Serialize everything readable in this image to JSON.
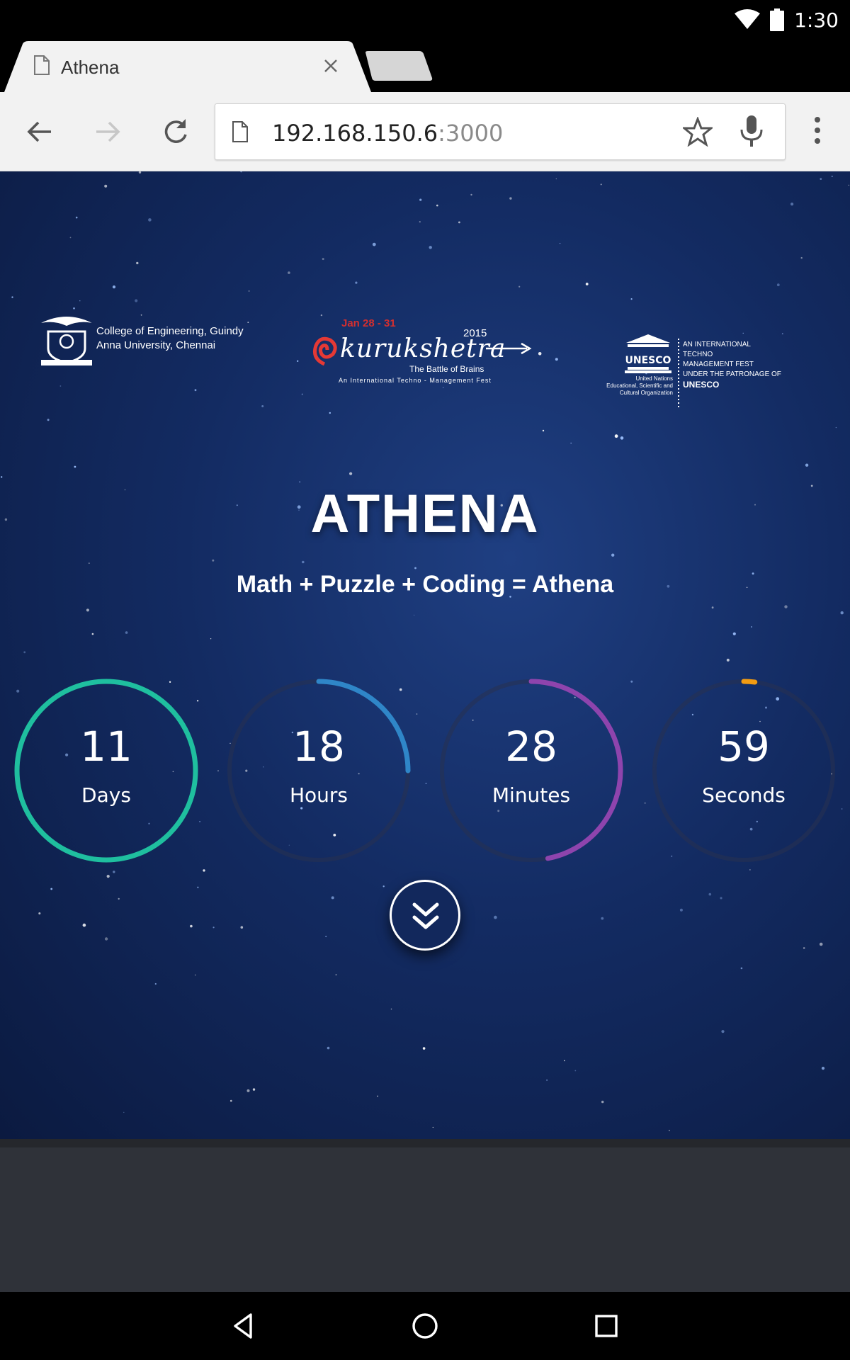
{
  "status_bar": {
    "time": "1:30",
    "icons": [
      "wifi-icon",
      "battery-icon"
    ]
  },
  "browser": {
    "tab_title": "Athena",
    "url_host": "192.168.150.6",
    "url_port": ":3000",
    "toolbar_icons": [
      "back-arrow-icon",
      "forward-arrow-icon",
      "reload-icon",
      "star-icon",
      "mic-icon",
      "overflow-menu-icon"
    ]
  },
  "page": {
    "logos": {
      "ceg": {
        "line1": "College of Engineering, Guindy",
        "line2": "Anna University, Chennai"
      },
      "kurukshetra": {
        "dates": "Jan 28 - 31",
        "year": "2015",
        "name": "kurukshetra",
        "tagline": "The Battle of Brains",
        "subline": "An International Techno - Management Fest"
      },
      "unesco": {
        "fest_line1": "AN INTERNATIONAL",
        "fest_line2": "TECHNO",
        "fest_line3": "MANAGEMENT FEST",
        "fest_line4": "UNDER THE PATRONAGE OF",
        "fest_line5": "UNESCO",
        "org_line1": "United Nations",
        "org_line2": "Educational, Scientific and",
        "org_line3": "Cultural Organization",
        "mark_text": "UNESCO"
      }
    },
    "title": "ATHENA",
    "subtitle": "Math + Puzzle + Coding = Athena",
    "countdown": [
      {
        "value": "11",
        "unit": "Days",
        "color": "#1fbf9f",
        "progress": 1.0
      },
      {
        "value": "18",
        "unit": "Hours",
        "color": "#2f86c8",
        "progress": 0.25
      },
      {
        "value": "28",
        "unit": "Minutes",
        "color": "#8e44ad",
        "progress": 0.47
      },
      {
        "value": "59",
        "unit": "Seconds",
        "color": "#f39c12",
        "progress": 0.02
      }
    ],
    "scroll_icon": "double-chevron-down-icon"
  },
  "nav_bar": {
    "icons": [
      "back-triangle-icon",
      "home-circle-icon",
      "recents-square-icon"
    ]
  },
  "colors": {
    "page_bg": "#132b62",
    "footer_bg": "#2f3239",
    "toolbar_bg": "#f2f2f2"
  }
}
